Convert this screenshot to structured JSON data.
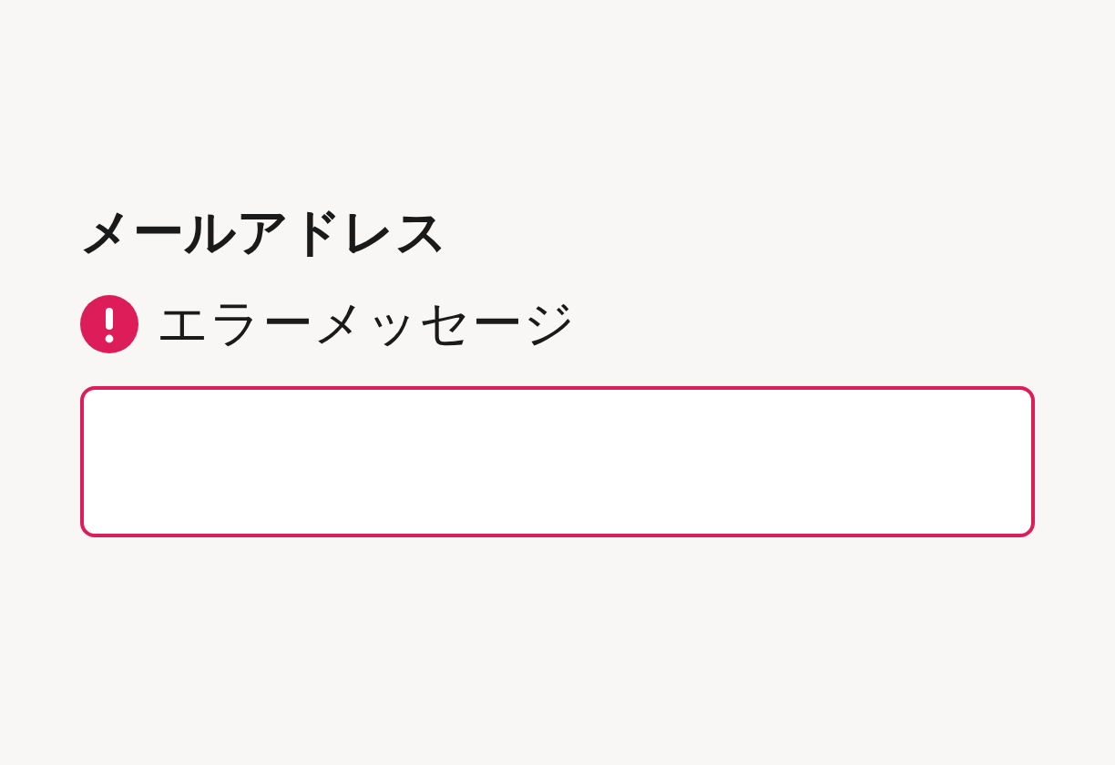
{
  "field": {
    "label": "メールアドレス",
    "error": {
      "message": "エラーメッセージ"
    },
    "invalid": true
  }
}
